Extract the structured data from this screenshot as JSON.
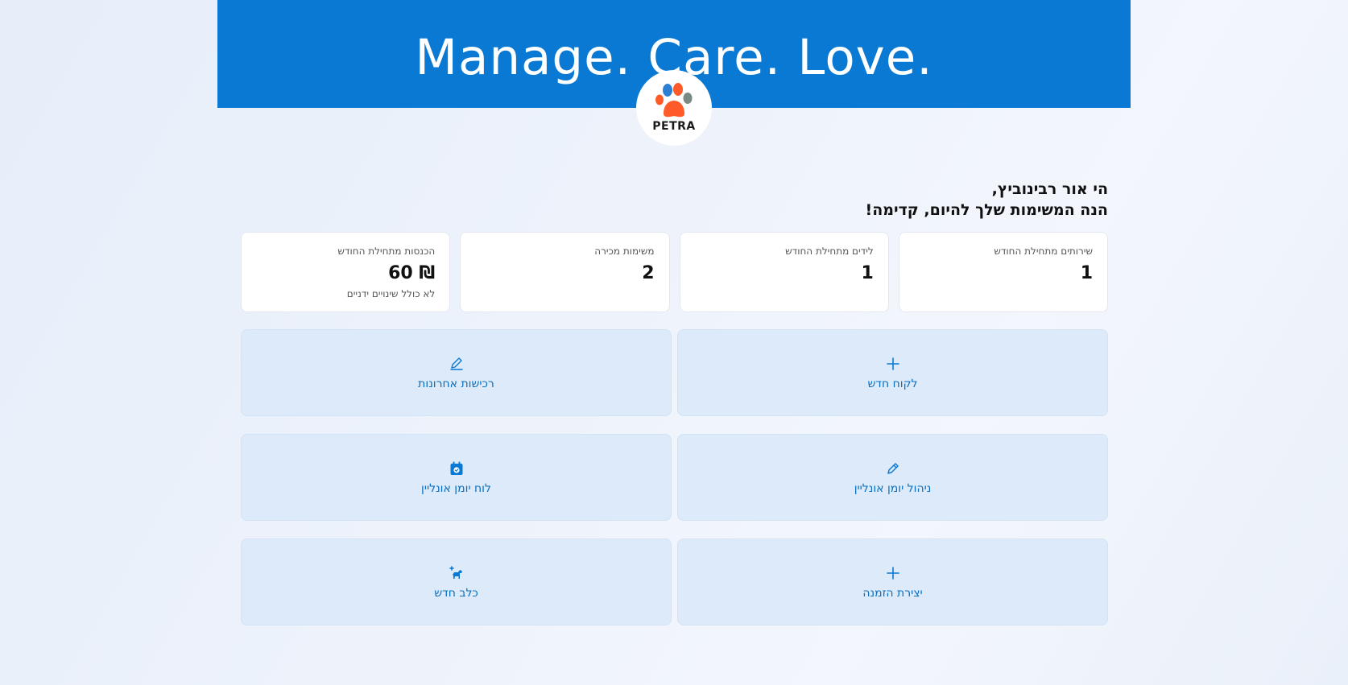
{
  "hero": {
    "title": "Manage. Care. Love."
  },
  "logo": {
    "text": "PETRA"
  },
  "greeting": {
    "line1": "הי אור רבינוביץ,",
    "line2": "הנה המשימות שלך להיום, קדימה!"
  },
  "stats": [
    {
      "label": "שירותים מתחילת החודש",
      "value": "1",
      "note": ""
    },
    {
      "label": "לידים מתחילת החודש",
      "value": "1",
      "note": ""
    },
    {
      "label": "משימות מכירה",
      "value": "2",
      "note": ""
    },
    {
      "label": "הכנסות מתחילת החודש",
      "value": "₪ 60",
      "note": "לא כולל שינויים ידניים"
    }
  ],
  "actions": [
    {
      "label": "לקוח חדש",
      "icon": "plus-icon"
    },
    {
      "label": "רכישות אחרונות",
      "icon": "pen-icon"
    },
    {
      "label": "ניהול יומן אונליין",
      "icon": "pencil-icon"
    },
    {
      "label": "לוח יומן אונליין",
      "icon": "calendar-check-icon"
    },
    {
      "label": "יצירת הזמנה",
      "icon": "plus-icon"
    },
    {
      "label": "כלב חדש",
      "icon": "dog-add-icon"
    }
  ],
  "colors": {
    "brand": "#0a79d3",
    "action_bg": "#ddeaf9",
    "action_text": "#0a6fc0",
    "paw_blue": "#2d7fd3",
    "paw_orange": "#ff5a2a",
    "paw_gray": "#7b8a84"
  }
}
